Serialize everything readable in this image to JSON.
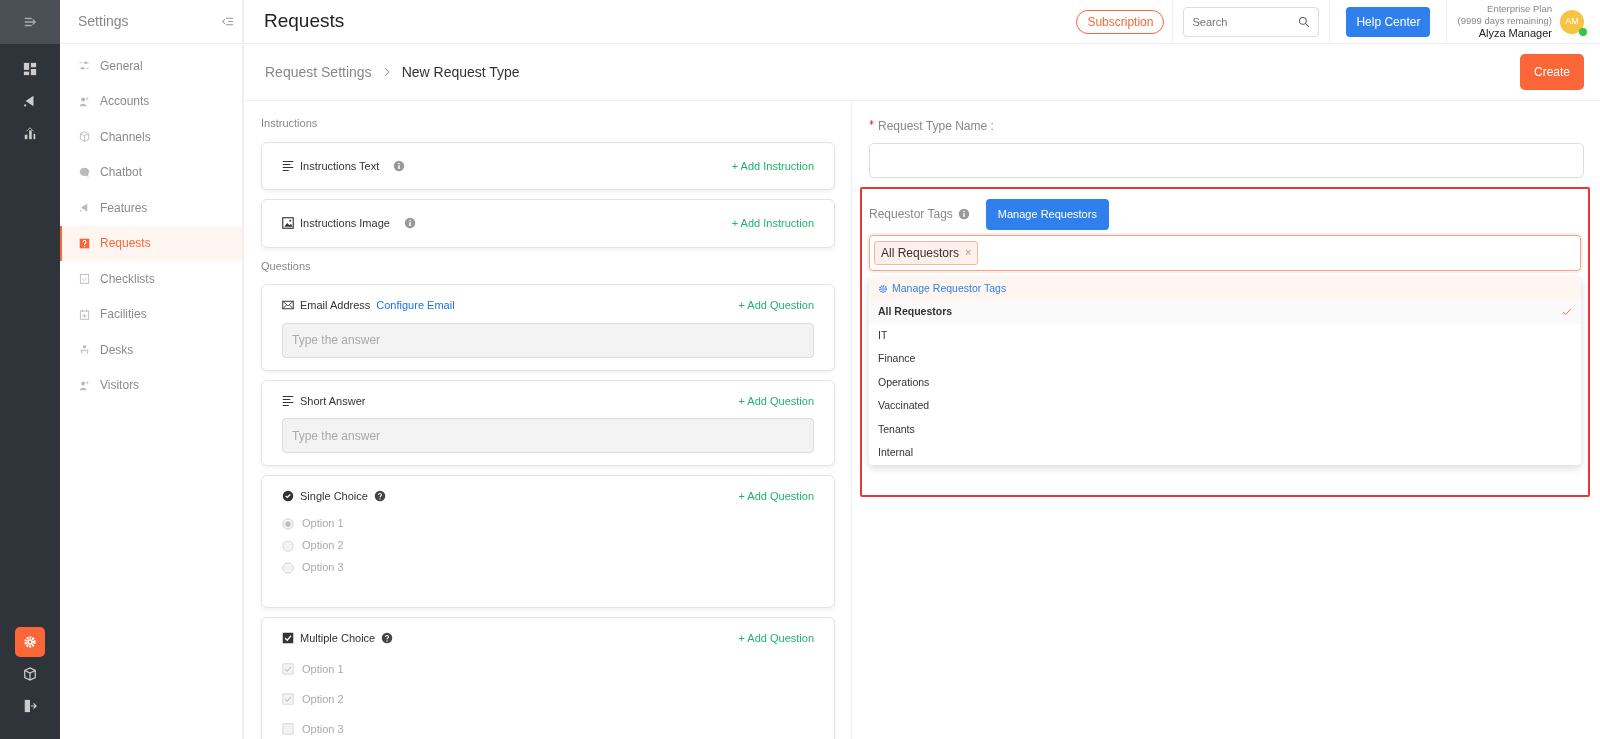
{
  "rail": {
    "items": [
      {
        "selected": false
      },
      {
        "selected": false
      },
      {
        "selected": false
      },
      {
        "selected": true
      },
      {
        "selected": false
      },
      {
        "selected": false
      }
    ]
  },
  "sidebar": {
    "title": "Settings",
    "items": [
      {
        "label": "General",
        "selected": false
      },
      {
        "label": "Accounts",
        "selected": false
      },
      {
        "label": "Channels",
        "selected": false
      },
      {
        "label": "Chatbot",
        "selected": false
      },
      {
        "label": "Features",
        "selected": false
      },
      {
        "label": "Requests",
        "selected": true
      },
      {
        "label": "Checklists",
        "selected": false
      },
      {
        "label": "Facilities",
        "selected": false
      },
      {
        "label": "Desks",
        "selected": false
      },
      {
        "label": "Visitors",
        "selected": false
      }
    ]
  },
  "header": {
    "title": "Requests",
    "subscription": "Subscription",
    "search": {
      "placeholder": "Search"
    },
    "help": "Help Center",
    "plan": "Enterprise Plan",
    "days": "(9999 days remaining)",
    "user": "Alyza Manager",
    "avatar": "AM",
    "online": true
  },
  "breadcrumb": {
    "items": [
      "Request Settings",
      "New Request Type"
    ],
    "create": "Create"
  },
  "instructions": {
    "heading": "Instructions",
    "items": [
      {
        "kind": "text",
        "label": "Instructions Text",
        "action": "+ Add Instruction"
      },
      {
        "kind": "image",
        "label": "Instructions Image",
        "action": "+ Add Instruction"
      }
    ]
  },
  "questions": {
    "heading": "Questions",
    "items": [
      {
        "kind": "email",
        "label": "Email Address",
        "link": "Configure Email",
        "action": "+ Add Question",
        "placeholder": "Type the answer"
      },
      {
        "kind": "short",
        "label": "Short Answer",
        "action": "+ Add Question",
        "placeholder": "Type the answer"
      },
      {
        "kind": "single",
        "label": "Single Choice",
        "action": "+ Add Question",
        "options": [
          {
            "label": "Option 1",
            "selected": true
          },
          {
            "label": "Option 2",
            "selected": false
          },
          {
            "label": "Option 3",
            "selected": false
          }
        ]
      },
      {
        "kind": "multiple",
        "label": "Multiple Choice",
        "action": "+ Add Question",
        "options": [
          {
            "label": "Option 1",
            "checked": true
          },
          {
            "label": "Option 2",
            "checked": true
          },
          {
            "label": "Option 3",
            "checked": false
          }
        ]
      }
    ]
  },
  "form": {
    "name_field": {
      "label": "Request Type Name :",
      "required": true
    },
    "requestor_tags": {
      "label": "Requestor Tags",
      "button": "Manage Requestors",
      "tags": [
        "All Requestors"
      ],
      "remove": "×",
      "dropdown": {
        "manage": "Manage Requestor Tags",
        "options": [
          {
            "label": "All Requestors",
            "selected": true
          },
          {
            "label": "IT",
            "selected": false
          },
          {
            "label": "Finance",
            "selected": false
          },
          {
            "label": "Operations",
            "selected": false
          },
          {
            "label": "Vaccinated",
            "selected": false
          },
          {
            "label": "Tenants",
            "selected": false
          },
          {
            "label": "Internal",
            "selected": false
          }
        ]
      }
    }
  }
}
